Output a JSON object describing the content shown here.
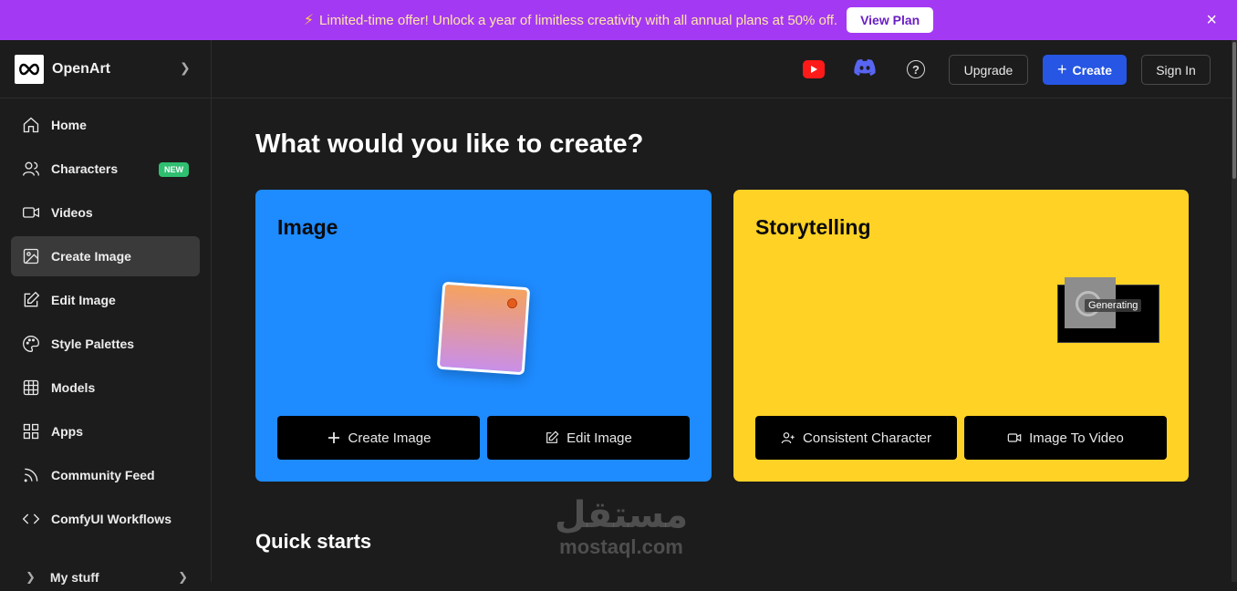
{
  "banner": {
    "message": "Limited-time offer!  Unlock a year of limitless creativity with all annual plans at 50% off.",
    "cta": "View Plan",
    "close": "×",
    "bolt": "⚡"
  },
  "brand": {
    "name": "OpenArt"
  },
  "sidebar": {
    "items": [
      {
        "label": "Home",
        "icon": "home-icon"
      },
      {
        "label": "Characters",
        "icon": "users-icon",
        "badge": "NEW"
      },
      {
        "label": "Videos",
        "icon": "video-icon"
      },
      {
        "label": "Create Image",
        "icon": "image-icon",
        "active": true
      },
      {
        "label": "Edit Image",
        "icon": "edit-icon"
      },
      {
        "label": "Style Palettes",
        "icon": "palette-icon"
      },
      {
        "label": "Models",
        "icon": "grid-icon"
      },
      {
        "label": "Apps",
        "icon": "apps-icon"
      },
      {
        "label": "Community Feed",
        "icon": "rss-icon"
      },
      {
        "label": "ComfyUI Workflows",
        "icon": "code-icon"
      }
    ],
    "mystuff": "My stuff"
  },
  "topbar": {
    "upgrade": "Upgrade",
    "create": "Create",
    "signin": "Sign In",
    "help": "?"
  },
  "main": {
    "title": "What would you like to create?",
    "cards": {
      "image": {
        "title": "Image",
        "buttons": [
          "Create Image",
          "Edit Image"
        ]
      },
      "story": {
        "title": "Storytelling",
        "generating": "Generating",
        "buttons": [
          "Consistent Character",
          "Image To Video"
        ]
      }
    },
    "quick_starts": "Quick starts"
  },
  "watermark": {
    "arabic": "مستقل",
    "latin": "mostaql.com"
  },
  "colors": {
    "banner": "#a439f3",
    "image_card": "#1e8bff",
    "story_card": "#ffd225",
    "primary": "#2656e3"
  }
}
